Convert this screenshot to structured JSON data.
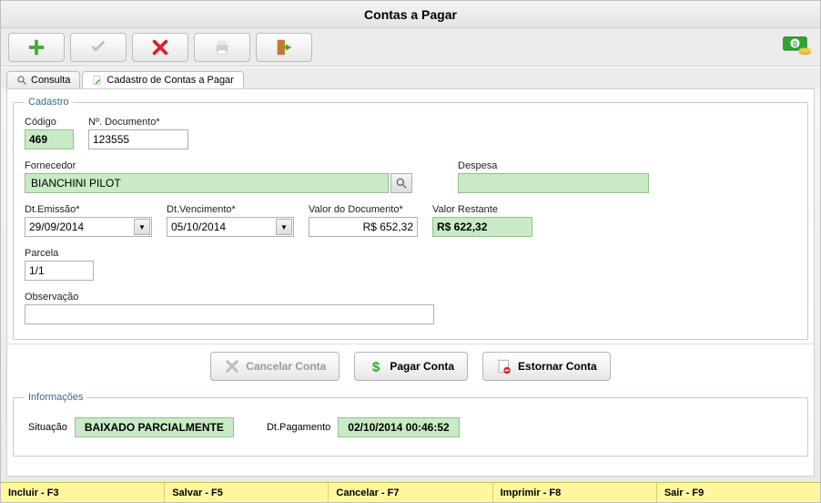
{
  "window": {
    "title": "Contas a Pagar"
  },
  "toolbar": {
    "add": "add",
    "ok": "ok",
    "cancel": "cancel",
    "print": "print",
    "exit": "exit",
    "money": "money"
  },
  "tabs": {
    "consulta": "Consulta",
    "cadastro": "Cadastro de Contas a Pagar"
  },
  "group_cadastro": "Cadastro",
  "fields": {
    "codigo_label": "Código",
    "codigo_value": "469",
    "documento_label": "Nº. Documento*",
    "documento_value": "123555",
    "fornecedor_label": "Fornecedor",
    "fornecedor_value": "BIANCHINI PILOT",
    "despesa_label": "Despesa",
    "despesa_value": "",
    "emissao_label": "Dt.Emissão*",
    "emissao_value": "29/09/2014",
    "vencimento_label": "Dt.Vencimento*",
    "vencimento_value": "05/10/2014",
    "valordoc_label": "Valor do Documento*",
    "valordoc_value": "R$ 652,32",
    "valorrest_label": "Valor Restante",
    "valorrest_value": "R$ 622,32",
    "parcela_label": "Parcela",
    "parcela_value": "1/1",
    "obs_label": "Observação",
    "obs_value": ""
  },
  "actions": {
    "cancelar": "Cancelar Conta",
    "pagar": "Pagar Conta",
    "estornar": "Estornar Conta"
  },
  "group_info": "Informações",
  "info": {
    "situacao_label": "Situação",
    "situacao_value": "BAIXADO PARCIALMENTE",
    "pagamento_label": "Dt.Pagamento",
    "pagamento_value": "02/10/2014 00:46:52"
  },
  "statusbar": {
    "incluir": "Incluir - F3",
    "salvar": "Salvar - F5",
    "cancelar": "Cancelar - F7",
    "imprimir": "Imprimir - F8",
    "sair": "Sair - F9"
  }
}
